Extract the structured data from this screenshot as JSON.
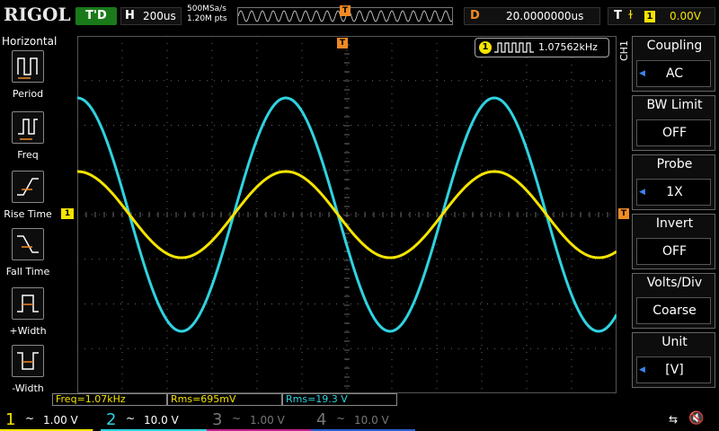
{
  "topbar": {
    "logo": "RIGOL",
    "run_state": "T'D",
    "timebase_label": "H",
    "timebase_value": "200us",
    "sample_rate": "500MSa/s",
    "memory_depth": "1.20M pts",
    "trigger_marker": "T",
    "delay_label": "D",
    "delay_value": "20.0000000us",
    "trigger_label": "T",
    "trigger_source": "1",
    "trigger_level": "0.00V"
  },
  "left_menu": {
    "title": "Horizontal",
    "items": [
      {
        "label": "Period",
        "icon": "period-icon"
      },
      {
        "label": "Freq",
        "icon": "freq-icon"
      },
      {
        "label": "Rise Time",
        "icon": "rise-time-icon"
      },
      {
        "label": "Fall Time",
        "icon": "fall-time-icon"
      },
      {
        "label": "+Width",
        "icon": "positive-width-icon"
      },
      {
        "label": "-Width",
        "icon": "negative-width-icon"
      }
    ]
  },
  "waveform": {
    "ch1_color": "#f5e400",
    "ch2_color": "#2fd3e0",
    "ch1_marker": "1",
    "trigger_marker": "T"
  },
  "freq_counter": {
    "channel": "1",
    "value": "1.07562kHz"
  },
  "measurements": [
    {
      "text": "Freq=1.07kHz",
      "color": "#f5e400"
    },
    {
      "text": "Rms=695mV",
      "color": "#f5e400"
    },
    {
      "text": "Rms=19.3 V",
      "color": "#2fd3e0"
    }
  ],
  "right_menu": {
    "channel_label": "CH1",
    "items": [
      {
        "title": "Coupling",
        "value": "AC"
      },
      {
        "title": "BW Limit",
        "value": "OFF"
      },
      {
        "title": "Probe",
        "value": "1X"
      },
      {
        "title": "Invert",
        "value": "OFF"
      },
      {
        "title": "Volts/Div",
        "value": "Coarse"
      },
      {
        "title": "Unit",
        "value": "[V]"
      }
    ]
  },
  "channels": [
    {
      "num": "1",
      "coupling": "~",
      "scale": "1.00 V",
      "color": "#f5e400"
    },
    {
      "num": "2",
      "coupling": "~",
      "scale": "10.0 V",
      "color": "#2fd3e0"
    },
    {
      "num": "3",
      "coupling": "~",
      "scale": "1.00 V",
      "color": "#c02090"
    },
    {
      "num": "4",
      "coupling": "~",
      "scale": "10.0 V",
      "color": "#2a5fd0"
    }
  ]
}
